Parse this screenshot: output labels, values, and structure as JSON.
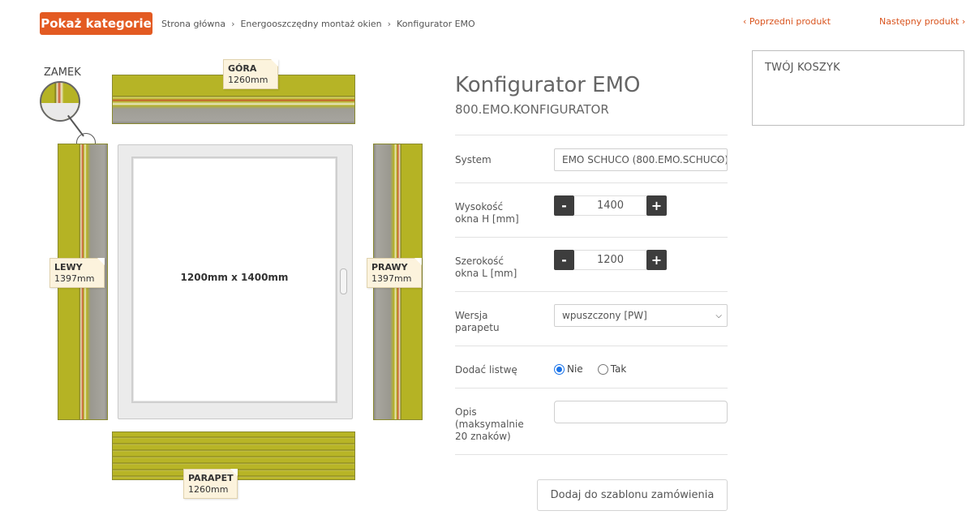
{
  "topbar": {
    "categories_button": "Pokaż kategorie",
    "breadcrumb": [
      "Strona główna",
      "Energooszczędny montaż okien",
      "Konfigurator EMO"
    ],
    "separator": "›",
    "prev_product": "‹ Poprzedni produkt",
    "next_product": "Następny produkt ›"
  },
  "drawing": {
    "lock_label": "ZAMEK",
    "top_tag": {
      "name": "GÓRA",
      "size": "1260mm"
    },
    "left_tag": {
      "name": "LEWY",
      "size": "1397mm"
    },
    "right_tag": {
      "name": "PRAWY",
      "size": "1397mm"
    },
    "bottom_tag": {
      "name": "PARAPET",
      "size": "1260mm"
    },
    "window_dimensions": "1200mm x 1400mm"
  },
  "product": {
    "title": "Konfigurator EMO",
    "sku": "800.EMO.KONFIGURATOR"
  },
  "form": {
    "system_label": "System",
    "system_value": "EMO SCHUCO (800.EMO.SCHUCO)",
    "height_label": "Wysokość okna H [mm]",
    "height_value": "1400",
    "width_label": "Szerokość okna L [mm]",
    "width_value": "1200",
    "minus": "-",
    "plus": "+",
    "sill_label": "Wersja parapetu",
    "sill_value": "wpuszczony [PW]",
    "strip_label": "Dodać listwę",
    "strip_options": [
      "Nie",
      "Tak"
    ],
    "strip_selected": "Nie",
    "description_label": "Opis (maksymalnie 20 znaków)",
    "description_value": "",
    "add_button": "Dodaj do szablonu zamówienia"
  },
  "cart": {
    "title": "TWÓJ KOSZYK"
  }
}
